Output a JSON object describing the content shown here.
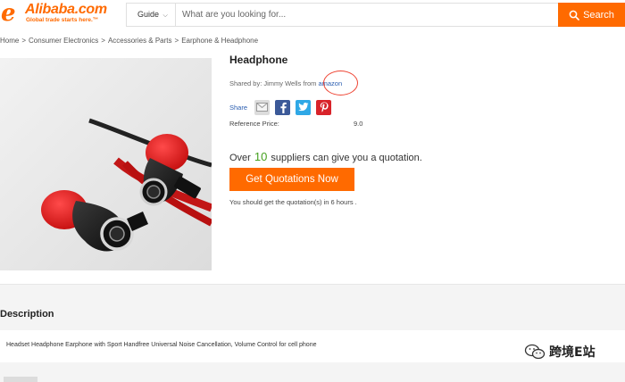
{
  "header": {
    "logo_mark": "e",
    "logo_text": "Alibaba.com",
    "logo_tagline": "Global trade starts here.™",
    "guide_label": "Guide",
    "search_placeholder": "What are you looking for...",
    "search_button_label": "Search"
  },
  "breadcrumb": {
    "items": [
      "Home",
      "Consumer Electronics",
      "Accessories & Parts",
      "Earphone & Headphone"
    ],
    "separator": ">"
  },
  "product": {
    "title": "Headphone",
    "shared_prefix": "Shared by: Jimmy Wells from ",
    "shared_source": "amazon",
    "share_label": "Share",
    "reference_price_label": "Reference Price:",
    "reference_price_value": "9.0",
    "quote_prefix": "Over ",
    "supplier_count": "10",
    "quote_suffix": " suppliers can give you a quotation.",
    "cta_label": "Get Quotations Now",
    "quote_note": "You should get the quotation(s) in 6 hours ."
  },
  "description": {
    "heading": "Description",
    "text": "Headset Headphone Earphone with Sport Handfree Universal Noise Cancellation, Volume Control for cell phone"
  },
  "watermark": {
    "text": "跨境E站"
  },
  "colors": {
    "accent": "#ff6a00",
    "link": "#2a5db0",
    "highlight": "#45a01f",
    "annotation": "#e43333"
  },
  "icons": {
    "email": "email-icon",
    "facebook": "facebook-icon",
    "twitter": "twitter-icon",
    "pinterest": "pinterest-icon",
    "search": "search-icon",
    "chevron": "chevron-down-icon"
  }
}
